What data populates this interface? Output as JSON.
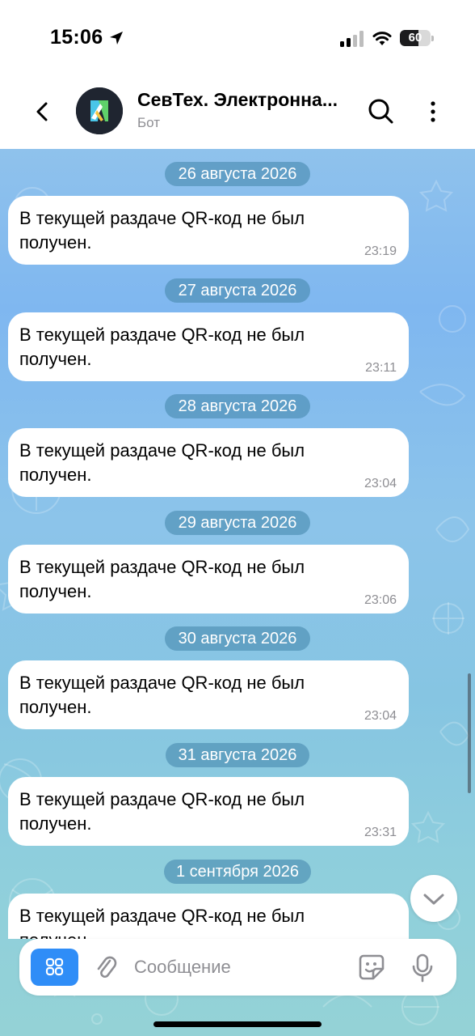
{
  "status_bar": {
    "time": "15:06",
    "battery": "60",
    "battery_level": 0.6,
    "icons": [
      "location-arrow-icon",
      "cellular-signal-icon",
      "wifi-icon",
      "battery-icon"
    ]
  },
  "header": {
    "title": "СевТех. Электронна...",
    "subtitle": "Бот",
    "icons": [
      "chevron-left-icon",
      "bot-logo-icon",
      "search-icon",
      "more-vertical-icon"
    ]
  },
  "messages": [
    {
      "date": "26 августа 2026",
      "text": "В текущей раздаче QR-код не был получен.",
      "time": "23:19"
    },
    {
      "date": "27 августа 2026",
      "text": "В текущей раздаче QR-код не был получен.",
      "time": "23:11"
    },
    {
      "date": "28 августа 2026",
      "text": "В текущей раздаче QR-код не был получен.",
      "time": "23:04"
    },
    {
      "date": "29 августа 2026",
      "text": "В текущей раздаче QR-код не был получен.",
      "time": "23:06"
    },
    {
      "date": "30 августа 2026",
      "text": "В текущей раздаче QR-код не был получен.",
      "time": "23:04"
    },
    {
      "date": "31 августа 2026",
      "text": "В текущей раздаче QR-код не был получен.",
      "time": "23:31"
    },
    {
      "date": "1 сентября 2026",
      "text": "В текущей раздаче QR-код не был получен.",
      "time": ""
    }
  ],
  "input": {
    "placeholder": "Сообщение",
    "icons": [
      "bot-menu-icon",
      "paperclip-icon",
      "sticker-icon",
      "microphone-icon"
    ]
  },
  "colors": {
    "accent": "#2f8df7",
    "chat_background": "#86c5e2",
    "date_pill": "#488ab0",
    "bubble": "#ffffff",
    "secondary_text": "#8e8e93"
  }
}
